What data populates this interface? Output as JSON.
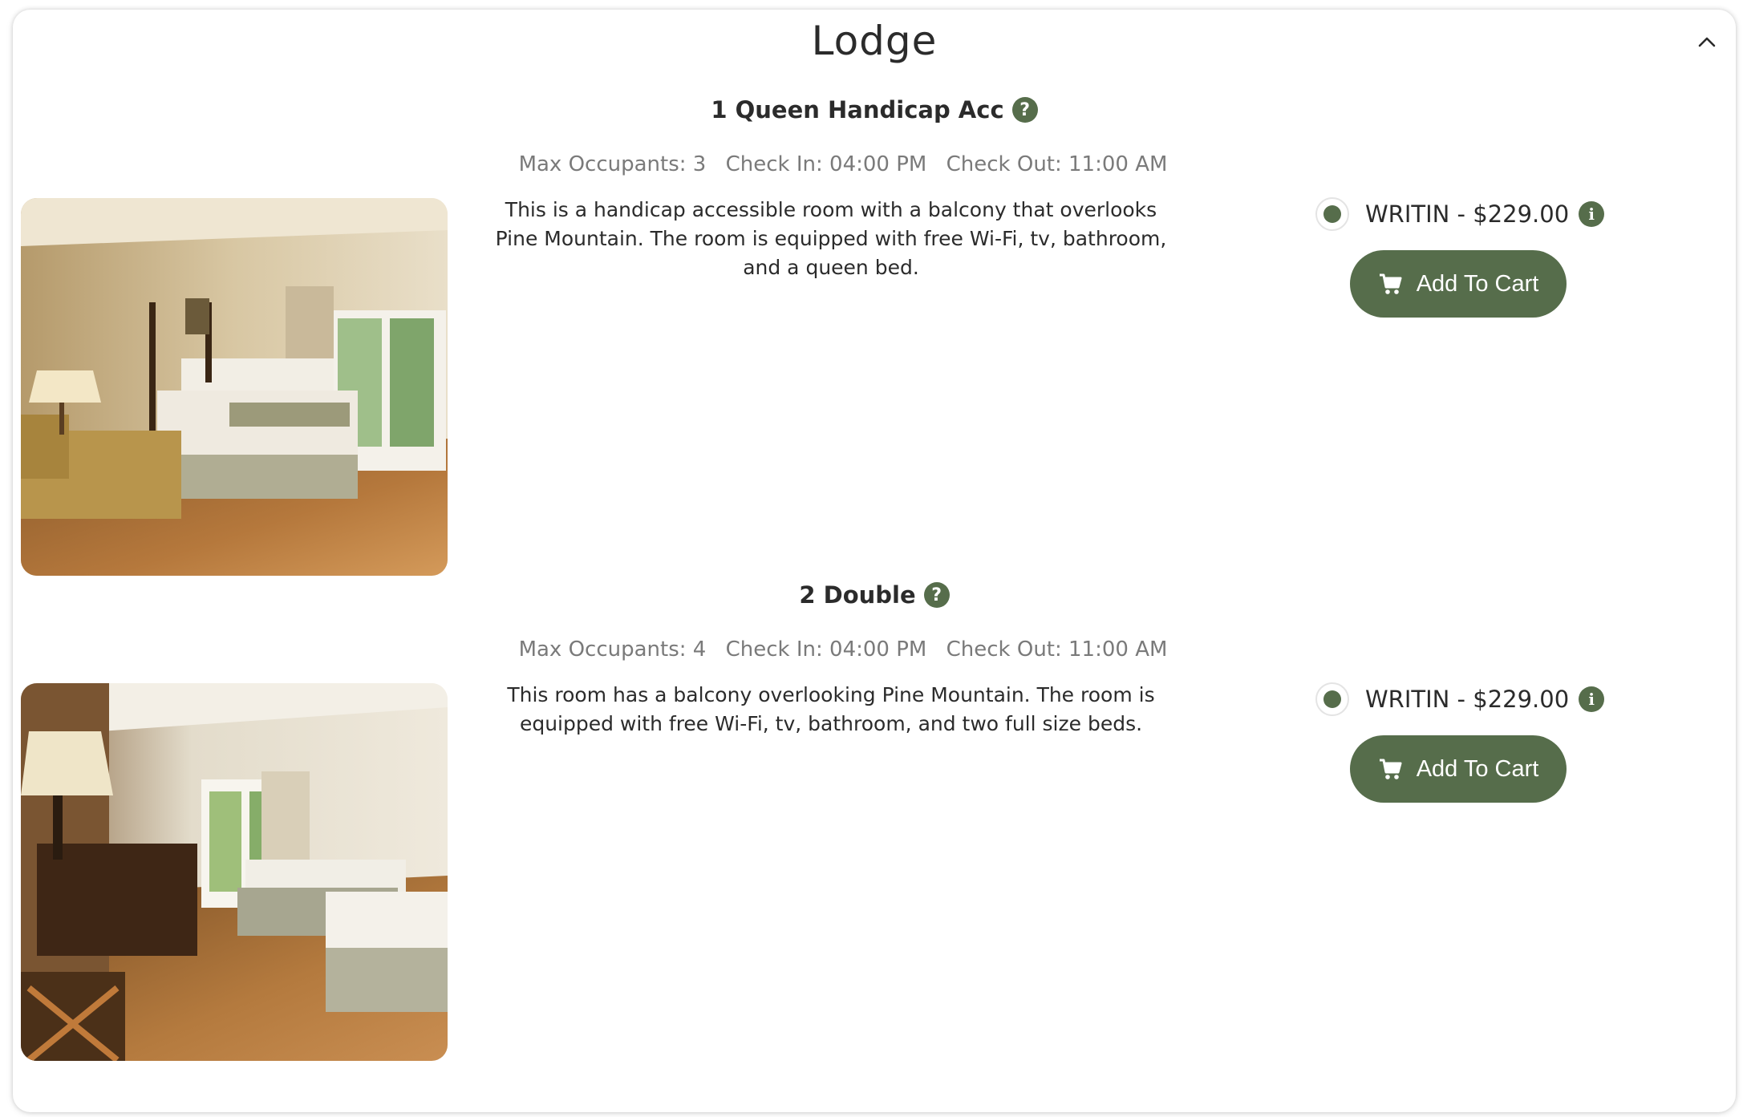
{
  "section": {
    "title": "Lodge",
    "collapse_icon": "chevron-up-icon"
  },
  "colors": {
    "accent": "#566d4b",
    "text": "#2b2b2b",
    "meta_text": "#7a7a7a"
  },
  "rooms": [
    {
      "name": "1 Queen Handicap Acc",
      "max_occupants": "Max Occupants: 3",
      "check_in": "Check In: 04:00 PM",
      "check_out": "Check Out: 11:00 AM",
      "description": "This is a handicap accessible room with a balcony that overlooks Pine Mountain. The room is equipped with free Wi-Fi, tv, bathroom, and a queen bed.",
      "rate_label": "WRITIN - $229.00",
      "rate_selected": true,
      "cart_label": "Add To Cart"
    },
    {
      "name": "2 Double",
      "max_occupants": "Max Occupants: 4",
      "check_in": "Check In: 04:00 PM",
      "check_out": "Check Out: 11:00 AM",
      "description": "This room has a balcony overlooking Pine Mountain. The room is equipped with free Wi-Fi, tv, bathroom, and two full size beds.",
      "rate_label": "WRITIN - $229.00",
      "rate_selected": true,
      "cart_label": "Add To Cart"
    }
  ]
}
